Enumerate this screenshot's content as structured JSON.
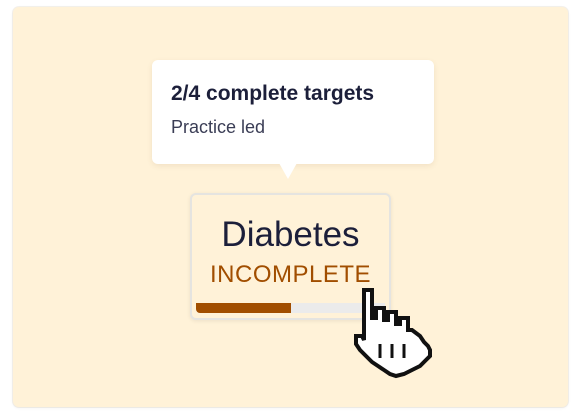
{
  "tooltip": {
    "title": "2/4 complete targets",
    "subtitle": "Practice led"
  },
  "card": {
    "title": "Diabetes",
    "status": "INCOMPLETE",
    "progress_fraction": 0.5
  },
  "colors": {
    "panel_background": "#fff2d8",
    "status_text": "#a14e00",
    "progress_fill": "#a14e00",
    "progress_track": "#ebebeb"
  },
  "icons": {
    "cursor": "pointer-hand-icon"
  }
}
